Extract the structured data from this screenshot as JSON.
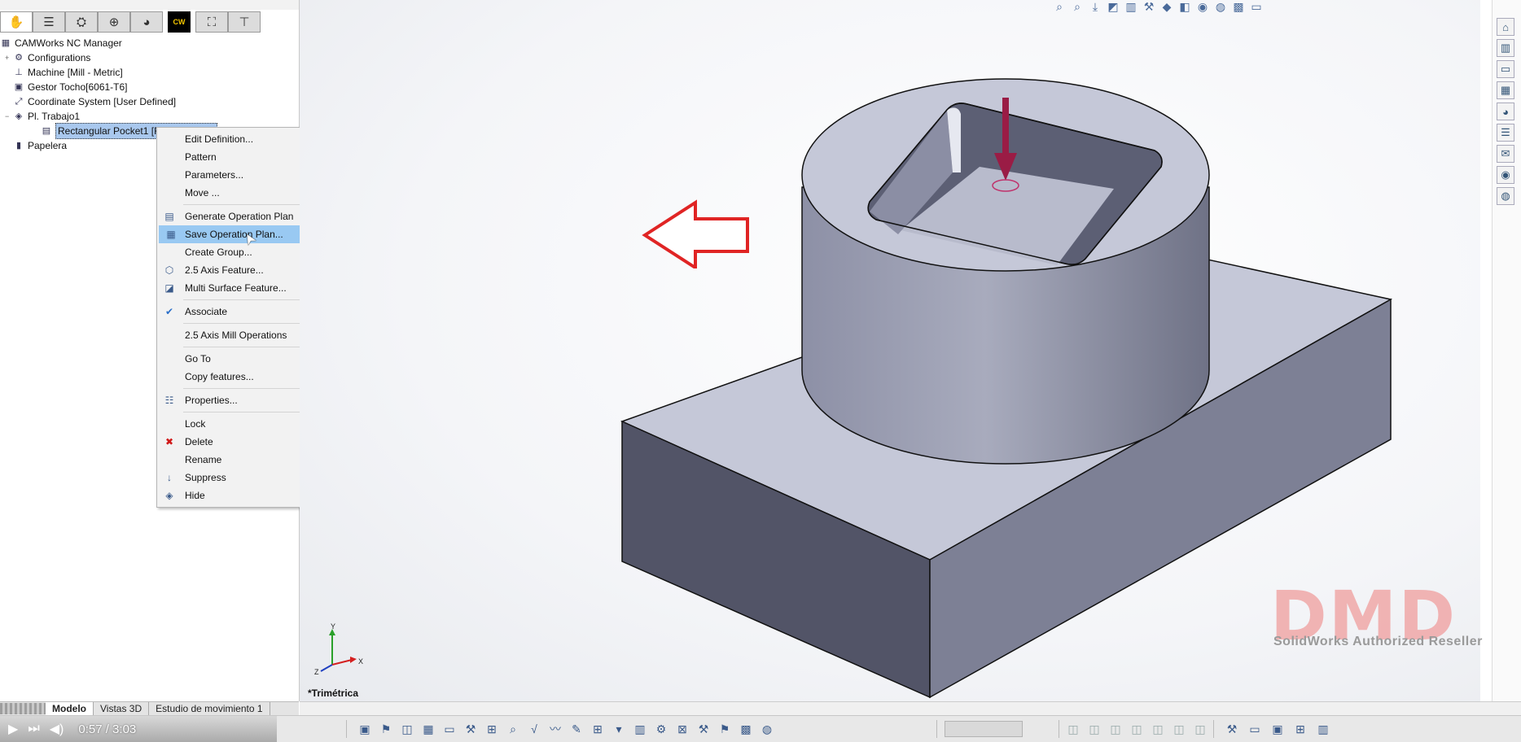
{
  "panel": {
    "tabs": [
      {
        "name": "feature-manager-tab",
        "glyph": "✋"
      },
      {
        "name": "property-manager-tab",
        "glyph": "☰"
      },
      {
        "name": "configuration-manager-tab",
        "glyph": "⛭"
      },
      {
        "name": "dimxpert-tab",
        "glyph": "⊕"
      },
      {
        "name": "display-manager-tab",
        "glyph": "◕"
      },
      {
        "name": "camworks-tab",
        "glyph": "CW"
      },
      {
        "name": "camworks-ops-tab",
        "glyph": "⛶"
      },
      {
        "name": "camworks-tools-tab",
        "glyph": "⊤"
      }
    ]
  },
  "tree": {
    "root": "CAMWorks NC Manager",
    "items": [
      {
        "label": "Configurations",
        "icon": "configurations-icon",
        "glyph": "⚙",
        "expand": "+"
      },
      {
        "label": "Machine [Mill - Metric]",
        "icon": "machine-icon",
        "glyph": "⊥",
        "expand": ""
      },
      {
        "label": "Gestor Tocho[6061-T6]",
        "icon": "stock-icon",
        "glyph": "▣",
        "expand": ""
      },
      {
        "label": "Coordinate System [User Defined]",
        "icon": "coordinate-system-icon",
        "glyph": "⤢",
        "expand": ""
      },
      {
        "label": "Pl. Trabajo1",
        "icon": "setup-icon",
        "glyph": "◈",
        "expand": "−"
      },
      {
        "label": "Rectangular Pocket1 [Rough-Finish]",
        "icon": "pocket-feature-icon",
        "glyph": "▤",
        "expand": "",
        "selected": true
      },
      {
        "label": "Papelera",
        "icon": "recycle-bin-icon",
        "glyph": "▮",
        "expand": ""
      }
    ]
  },
  "menu": {
    "groups": [
      [
        {
          "label": "Edit Definition...",
          "icon": "",
          "submenu": false
        },
        {
          "label": "Pattern",
          "icon": "",
          "submenu": true
        },
        {
          "label": "Parameters...",
          "icon": "",
          "submenu": false
        },
        {
          "label": "Move ...",
          "icon": "",
          "submenu": false
        }
      ],
      [
        {
          "label": "Generate Operation Plan",
          "icon": "generate-plan-icon",
          "glyph": "▤",
          "submenu": false
        },
        {
          "label": "Save Operation Plan...",
          "icon": "save-plan-icon",
          "glyph": "▦",
          "submenu": false,
          "highlighted": true
        },
        {
          "label": "Create Group...",
          "icon": "",
          "submenu": false
        },
        {
          "label": "2.5 Axis Feature...",
          "icon": "axis-feature-icon",
          "glyph": "⬡",
          "submenu": false
        },
        {
          "label": "Multi Surface Feature...",
          "icon": "multi-surface-icon",
          "glyph": "◪",
          "submenu": false
        }
      ],
      [
        {
          "label": "Associate",
          "icon": "check-icon",
          "glyph": "✔",
          "submenu": false
        }
      ],
      [
        {
          "label": "2.5 Axis Mill Operations",
          "icon": "",
          "submenu": true
        }
      ],
      [
        {
          "label": "Go To",
          "icon": "",
          "submenu": true
        },
        {
          "label": "Copy features...",
          "icon": "",
          "submenu": false
        }
      ],
      [
        {
          "label": "Properties...",
          "icon": "properties-icon",
          "glyph": "☷",
          "submenu": false
        }
      ],
      [
        {
          "label": "Lock",
          "icon": "",
          "submenu": false
        },
        {
          "label": "Delete",
          "icon": "delete-icon",
          "glyph": "✖",
          "submenu": false
        },
        {
          "label": "Rename",
          "icon": "",
          "submenu": false
        },
        {
          "label": "Suppress",
          "icon": "suppress-icon",
          "glyph": "↓",
          "submenu": false
        },
        {
          "label": "Hide",
          "icon": "hide-icon",
          "glyph": "◈",
          "submenu": false
        }
      ]
    ]
  },
  "viewport": {
    "view_label": "*Trimétrica",
    "triad": {
      "x": "X",
      "y": "Y",
      "z": "Z"
    }
  },
  "watermark": {
    "logo": "DMD",
    "subtitle": "SolidWorks Authorized Reseller"
  },
  "bottom_tabs": [
    "Modelo",
    "Vistas 3D",
    "Estudio de movimiento 1"
  ],
  "video": {
    "time": "0:57 / 3:03"
  },
  "colors": {
    "part_top": "#c5c8d8",
    "part_side_light": "#9fa2b6",
    "part_side_dark": "#525467",
    "tool_arrow": "#9a1c45",
    "callout": "#e02424",
    "menu_highlight": "#99c9f2"
  }
}
